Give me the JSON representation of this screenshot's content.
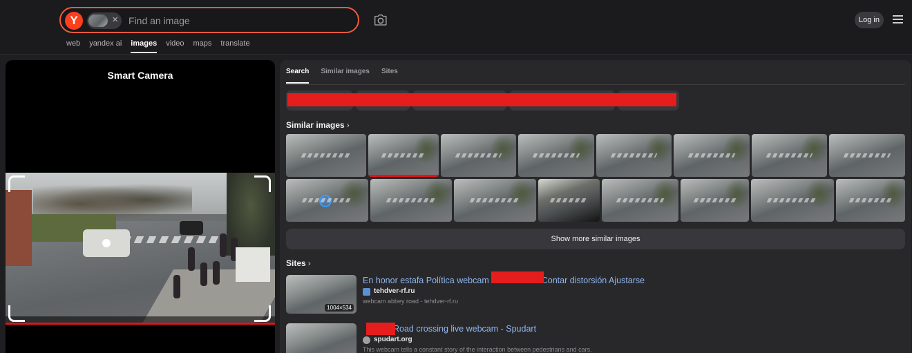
{
  "header": {
    "logo_letter": "Y",
    "search_placeholder": "Find an image",
    "chip_close": "×",
    "nav_tabs": [
      "web",
      "yandex ai",
      "images",
      "video",
      "maps",
      "translate"
    ],
    "active_tab": "images",
    "login_label": "Log in"
  },
  "left_panel": {
    "title": "Smart Camera"
  },
  "right_panel": {
    "tabs": [
      "Search",
      "Similar images",
      "Sites"
    ],
    "active_tab": "Search",
    "similar_title": "Similar images",
    "chevron": "›",
    "show_more_label": "Show more similar images",
    "sites_title": "Sites",
    "sites": [
      {
        "title_part1": "En honor estafa Política webcam",
        "title_part2": "Contar distorsión Ajustarse",
        "domain": "tehdver-rf.ru",
        "desc": "webcam abbey road - tehdver-rf.ru",
        "dims": "1004×534"
      },
      {
        "title_part1": "",
        "title_part2": "Road crossing live webcam - Spudart",
        "domain": "spudart.org",
        "desc": "This webcam tells a constant story of the interaction between pedestrians and cars."
      }
    ]
  },
  "colors": {
    "accent": "#f25a3c",
    "logo": "#fc3f1d",
    "link": "#8fb6ef",
    "redaction": "#e51d1d",
    "background": "#1f1f21"
  }
}
